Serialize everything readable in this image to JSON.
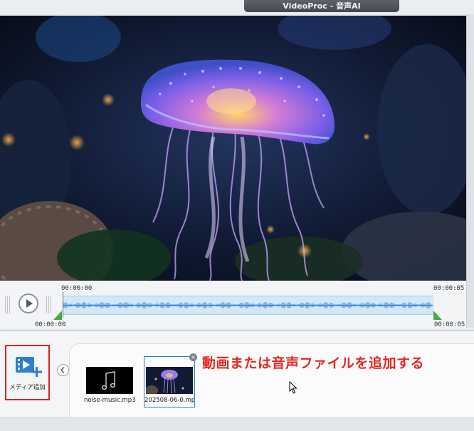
{
  "window": {
    "title": "VideoProc - 音声AI"
  },
  "timeline": {
    "start_top": "00:00:00",
    "end_top": "00:00:05",
    "start_bottom": "00:00:00",
    "end_bottom": "00:00:05"
  },
  "media": {
    "add_label": "メディア追加",
    "clips": [
      {
        "name": "noise-music.mp3",
        "kind": "music-note-icon"
      },
      {
        "name": "202508-06-0.mp",
        "kind": "video-thumbnail"
      }
    ]
  },
  "annotation": {
    "text": "動画または音声ファイルを追加する"
  },
  "colors": {
    "accent": "#2a7fd0",
    "annotation": "#e8261f",
    "marker": "#3fae3a"
  }
}
